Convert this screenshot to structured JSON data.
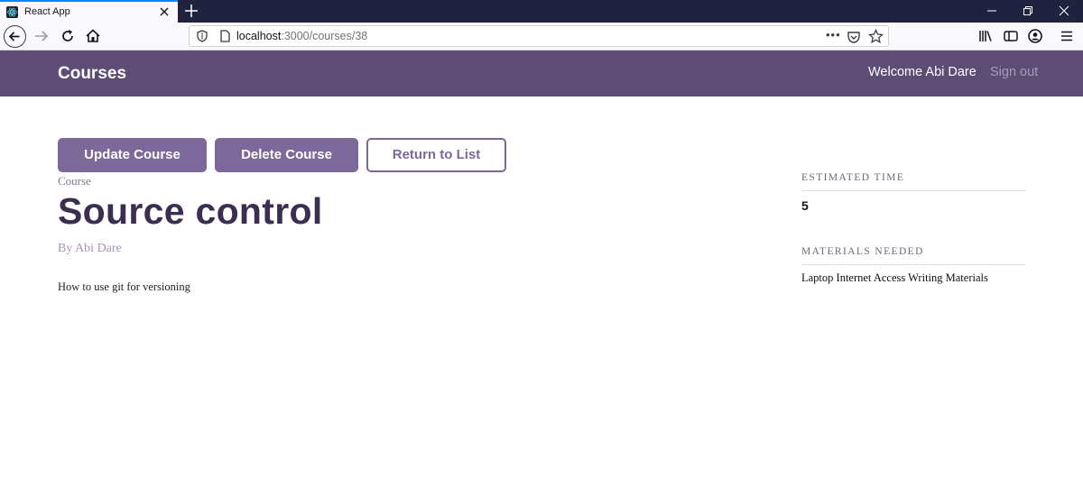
{
  "browser": {
    "tab_title": "React App",
    "url_host": "localhost",
    "url_rest": ":3000/courses/38",
    "url_dots": "•••"
  },
  "header": {
    "logo": "Courses",
    "welcome": "Welcome Abi Dare",
    "sign_out": "Sign out",
    "background_color": "#5d4c74"
  },
  "actions": {
    "update_label": "Update Course",
    "delete_label": "Delete Course",
    "return_label": "Return to List",
    "accent_color": "#7d6999"
  },
  "course": {
    "label": "Course",
    "title": "Source control",
    "author": "By Abi Dare",
    "description": "How to use git for versioning"
  },
  "sidebar": {
    "estimated_time_heading": "ESTIMATED TIME",
    "estimated_time_value": "5",
    "materials_heading": "MATERIALS NEEDED",
    "materials_value": "Laptop Internet Access Writing Materials"
  }
}
